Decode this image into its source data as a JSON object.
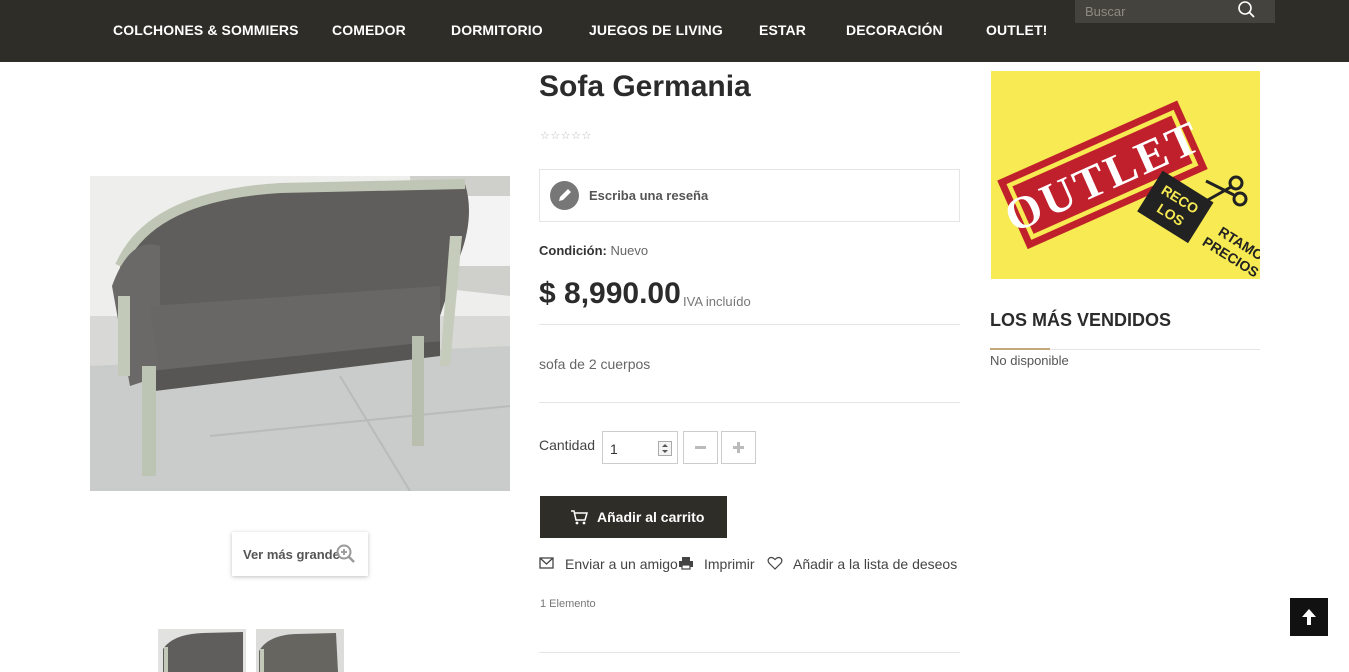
{
  "nav": {
    "items": [
      "COLCHONES & SOMMIERS",
      "COMEDOR",
      "DORMITORIO",
      "JUEGOS DE LIVING",
      "ESTAR",
      "DECORACIÓN",
      "OUTLET!"
    ],
    "search_placeholder": "Buscar"
  },
  "product": {
    "title": "Sofa Germania",
    "stars": "☆☆☆☆☆",
    "review_label": "Escriba una reseña",
    "condition_label": "Condición:",
    "condition_value": "Nuevo",
    "price": "$ 8,990.00",
    "tax_note": "IVA incluído",
    "description": "sofa de 2 cuerpos",
    "quantity_label": "Cantidad",
    "quantity_value": "1",
    "add_to_cart": "Añadir al carrito",
    "actions": {
      "send_friend": "Enviar a un amigo",
      "print": "Imprimir",
      "wishlist": "Añadir a la lista de deseos"
    },
    "items_count": "1 Elemento",
    "zoom_label": "Ver más grande"
  },
  "sidebar": {
    "banner_text": "OUTLET",
    "banner_subtext_1": "RECO",
    "banner_subtext_2": "LOS",
    "banner_subtext_3": "RTAMOS",
    "banner_subtext_4": "PRECIOS",
    "best_sellers_title": "LOS MÁS VENDIDOS",
    "best_sellers_empty": "No disponible"
  },
  "colors": {
    "topbar": "#2f2d27",
    "banner_yellow": "#f7ea52",
    "stamp_red": "#c0202b",
    "accent": "#c4a77a"
  }
}
